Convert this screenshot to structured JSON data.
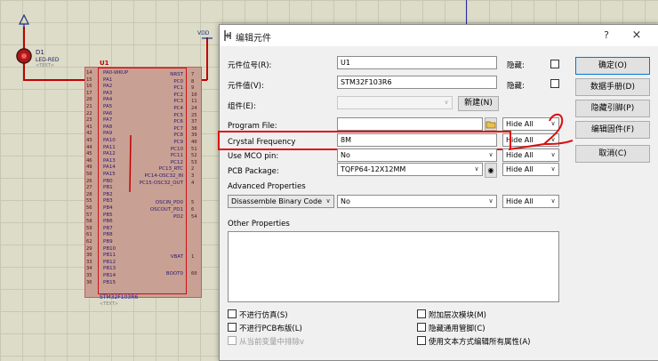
{
  "schematic": {
    "led": {
      "ref": "D1",
      "type": "LED-RED",
      "text": "<TEXT>"
    },
    "vdd_label": "VDD",
    "chip": {
      "ref": "U1",
      "part": "STM32F103R6",
      "text": "<TEXT>"
    },
    "left_pins": [
      {
        "num": "14",
        "name": "PA0-WKUP"
      },
      {
        "num": "15",
        "name": "PA1"
      },
      {
        "num": "16",
        "name": "PA2"
      },
      {
        "num": "17",
        "name": "PA3"
      },
      {
        "num": "20",
        "name": "PA4"
      },
      {
        "num": "21",
        "name": "PA5"
      },
      {
        "num": "22",
        "name": "PA6"
      },
      {
        "num": "23",
        "name": "PA7"
      },
      {
        "num": "41",
        "name": "PA8"
      },
      {
        "num": "42",
        "name": "PA9"
      },
      {
        "num": "43",
        "name": "PA10"
      },
      {
        "num": "44",
        "name": "PA11"
      },
      {
        "num": "45",
        "name": "PA12"
      },
      {
        "num": "46",
        "name": "PA13"
      },
      {
        "num": "49",
        "name": "PA14"
      },
      {
        "num": "50",
        "name": "PA15"
      },
      {
        "num": "26",
        "name": "PB0"
      },
      {
        "num": "27",
        "name": "PB1"
      },
      {
        "num": "28",
        "name": "PB2"
      },
      {
        "num": "55",
        "name": "PB3"
      },
      {
        "num": "56",
        "name": "PB4"
      },
      {
        "num": "57",
        "name": "PB5"
      },
      {
        "num": "58",
        "name": "PB6"
      },
      {
        "num": "59",
        "name": "PB7"
      },
      {
        "num": "61",
        "name": "PB8"
      },
      {
        "num": "62",
        "name": "PB9"
      },
      {
        "num": "29",
        "name": "PB10"
      },
      {
        "num": "30",
        "name": "PB11"
      },
      {
        "num": "33",
        "name": "PB12"
      },
      {
        "num": "34",
        "name": "PB13"
      },
      {
        "num": "35",
        "name": "PB14"
      },
      {
        "num": "36",
        "name": "PB15"
      }
    ],
    "right_pins": [
      {
        "num": "7",
        "name": "NRST"
      },
      {
        "num": "8",
        "name": "PC0"
      },
      {
        "num": "9",
        "name": "PC1"
      },
      {
        "num": "10",
        "name": "PC2"
      },
      {
        "num": "11",
        "name": "PC3"
      },
      {
        "num": "24",
        "name": "PC4"
      },
      {
        "num": "25",
        "name": "PC5"
      },
      {
        "num": "37",
        "name": "PC6"
      },
      {
        "num": "38",
        "name": "PC7"
      },
      {
        "num": "39",
        "name": "PC8"
      },
      {
        "num": "40",
        "name": "PC9"
      },
      {
        "num": "51",
        "name": "PC10"
      },
      {
        "num": "52",
        "name": "PC11"
      },
      {
        "num": "53",
        "name": "PC12"
      },
      {
        "num": "2",
        "name": "PC13_RTC"
      },
      {
        "num": "3",
        "name": "PC14-OSC32_IN"
      },
      {
        "num": "4",
        "name": "PC15-OSC32_OUT"
      },
      {
        "num": "5",
        "name": "OSCIN_PD0"
      },
      {
        "num": "6",
        "name": "OSCOUT_PD1"
      },
      {
        "num": "54",
        "name": "PD2"
      },
      {
        "num": "1",
        "name": "VBAT"
      },
      {
        "num": "60",
        "name": "BOOT0"
      }
    ]
  },
  "dialog": {
    "title": "编辑元件",
    "help_icon": "?",
    "close_icon": "×",
    "fields": {
      "ref_label": "元件位号(R):",
      "ref_value": "U1",
      "value_label": "元件值(V):",
      "value_value": "STM32F103R6",
      "group_label": "组件(E):",
      "group_value": "",
      "hidden1_label": "隐藏:",
      "hidden2_label": "隐藏:",
      "new_button": "新建(N)",
      "program_file_label": "Program File:",
      "program_file_value": "",
      "crystal_label": "Crystal Frequency",
      "crystal_value": "8M",
      "mco_label": "Use MCO pin:",
      "mco_value": "No",
      "pcb_label": "PCB Package:",
      "pcb_value": "TQFP64-12X12MM",
      "advanced_label": "Advanced Properties",
      "advanced_select": "Disassemble Binary Code",
      "advanced_value": "No",
      "other_label": "Other Properties",
      "hide_all": "Hide All"
    },
    "buttons": {
      "ok": "确定(O)",
      "datasheet": "数据手册(D)",
      "hidden_pins": "隐藏引脚(P)",
      "edit_firmware": "编辑固件(F)",
      "cancel": "取消(C)"
    },
    "checkboxes": {
      "exclude_sim": "不进行仿真(S)",
      "exclude_pcb": "不进行PCB布版(L)",
      "exclude_bom": "从当前变量中排除v",
      "attach_hierarchy": "附加层次模块(M)",
      "hide_common_pins": "隐藏通用管脚(C)",
      "edit_all_props": "使用文本方式编辑所有属性(A)"
    }
  }
}
